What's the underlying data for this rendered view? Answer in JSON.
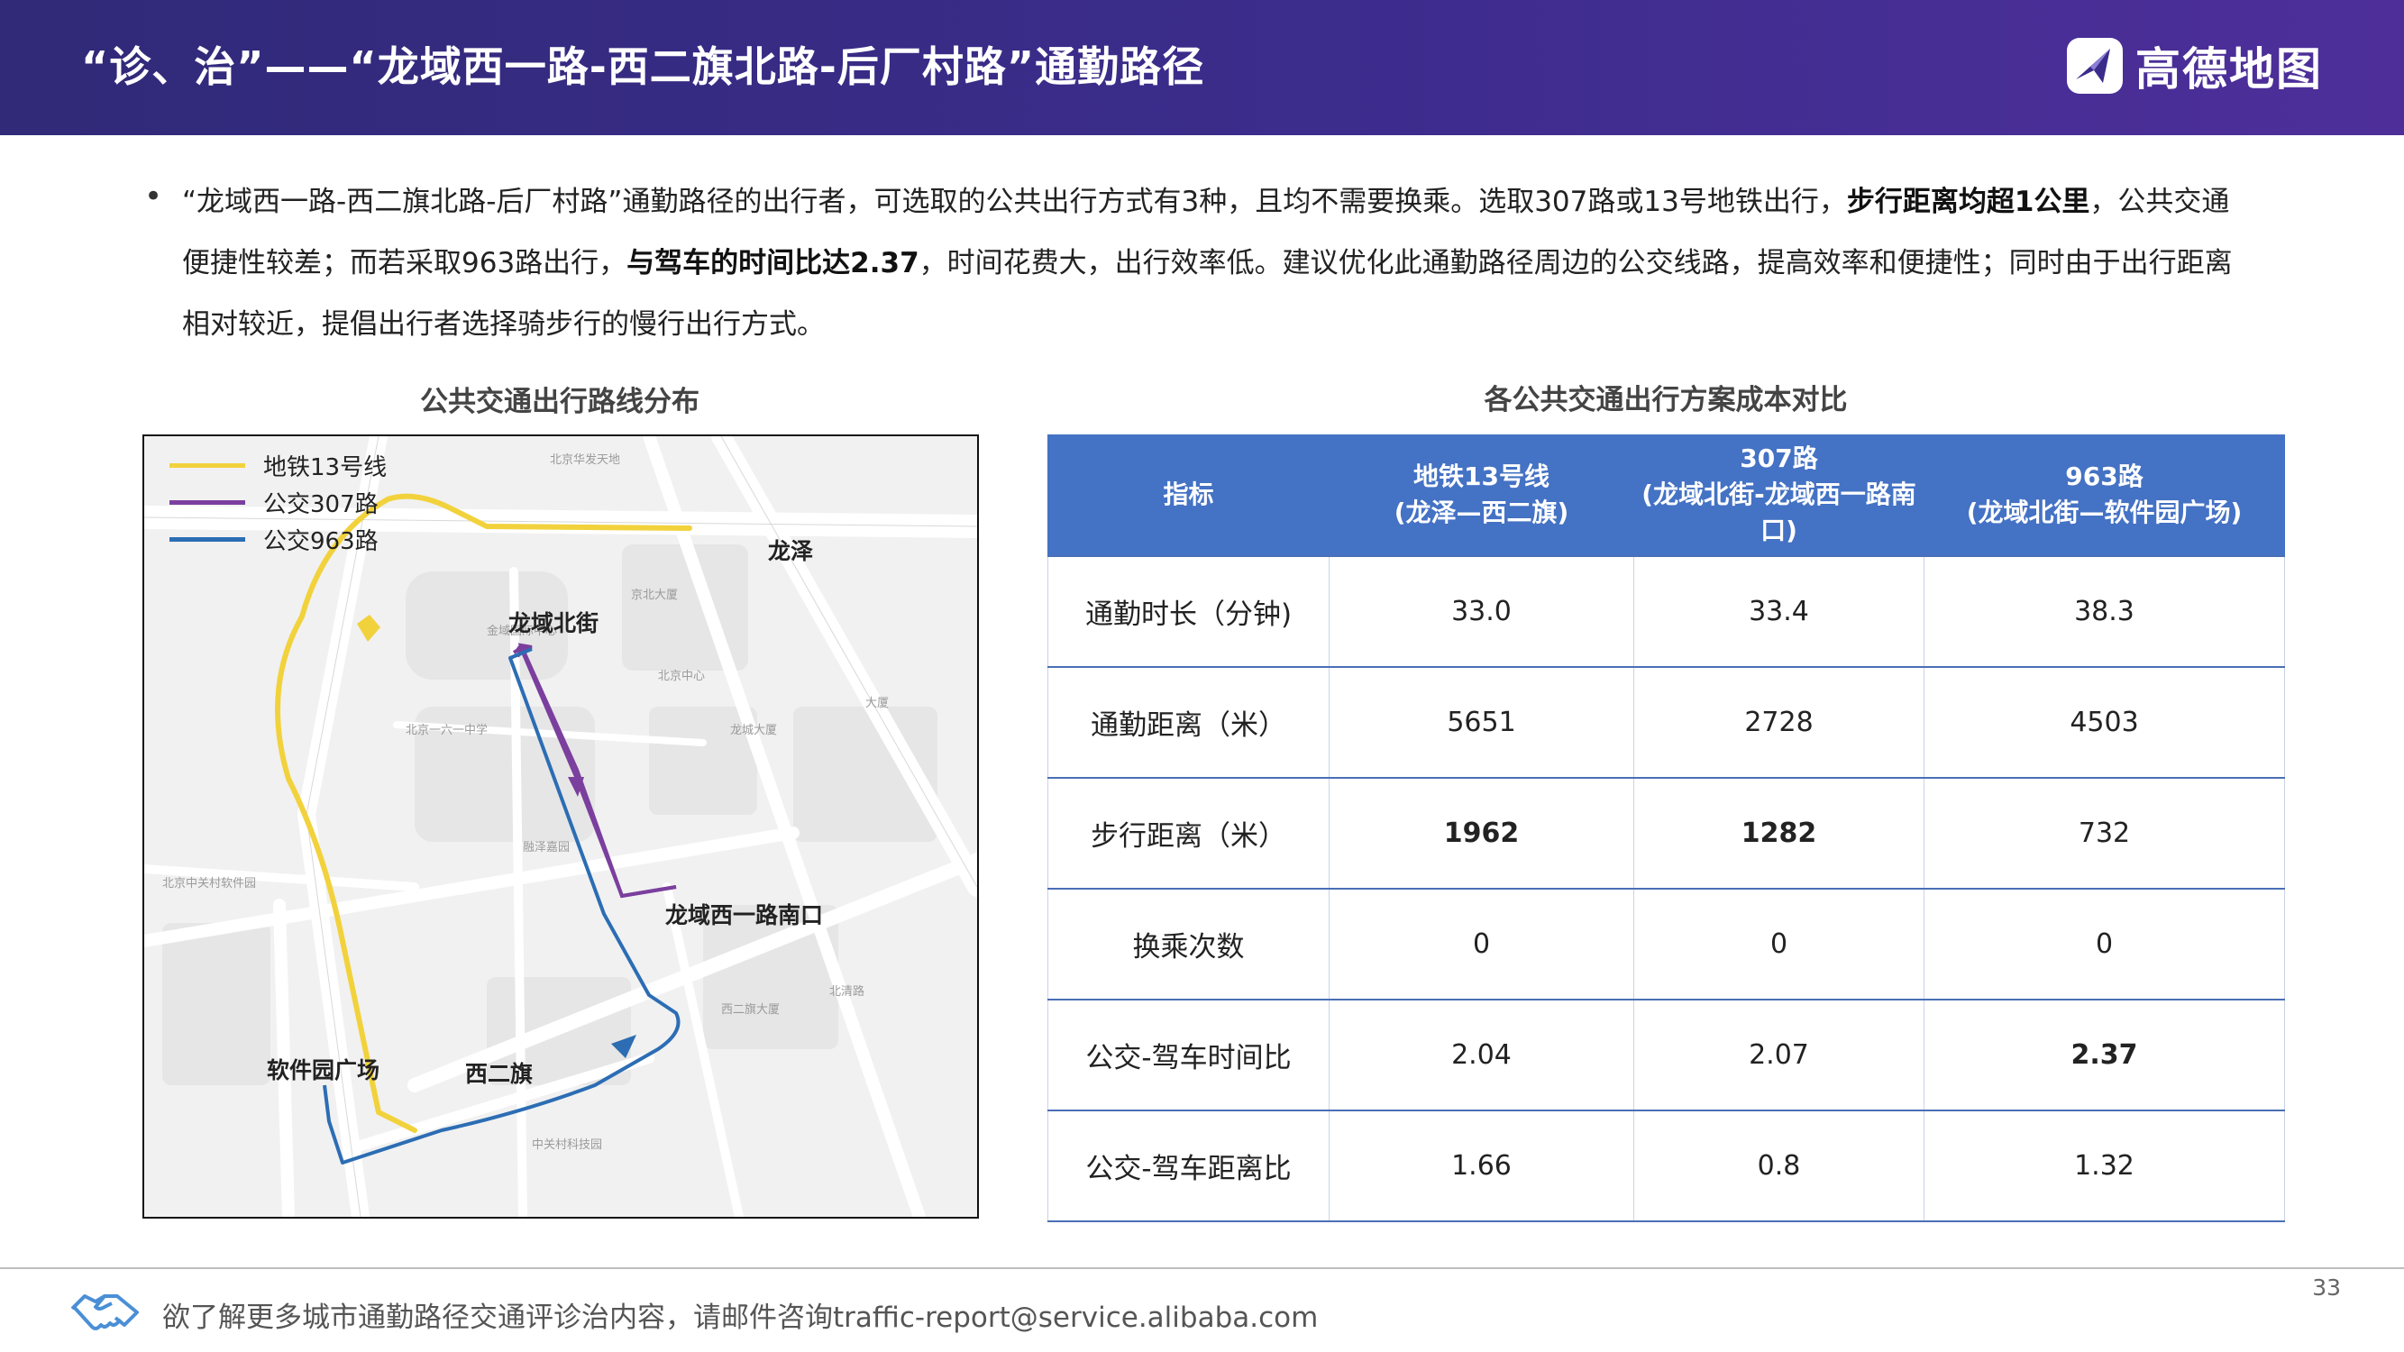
{
  "header": {
    "title": "“诊、治”——“龙域西一路-西二旗北路-后厂村路”通勤路径",
    "brand": "高德地图",
    "brand_icon": "gaode-logo-icon"
  },
  "paragraph": {
    "seg1": "“龙域西一路-西二旗北路-后厂村路”通勤路径的出行者，可选取的公共出行方式有3种，且均不需要换乘。选取307路或13号地铁出行，",
    "bold1": "步行距离均超1公里",
    "seg2": "，公共交通便捷性较差；而若采取963路出行，",
    "bold2": "与驾车的时间比达2.37",
    "seg3": "，时间花费大，出行效率低。建议优化此通勤路径周边的公交线路，提高效率和便捷性；同时由于出行距离相对较近，提倡出行者选择骑步行的慢行出行方式。"
  },
  "map": {
    "title": "公共交通出行路线分布",
    "legend": [
      {
        "label": "地铁13号线",
        "color": "#f2d23c"
      },
      {
        "label": "公交307路",
        "color": "#7b3f9e"
      },
      {
        "label": "公交963路",
        "color": "#2c6db4"
      }
    ],
    "labels": {
      "longze": "龙泽",
      "longyu_beijie": "龙域北街",
      "longyu_xiyilu_nankou": "龙域西一路南口",
      "ruanjianyuan_guangchang": "软件园广场",
      "xierqi": "西二旗"
    }
  },
  "table": {
    "title": "各公共交通出行方案成本对比",
    "headers": [
      {
        "line1": "指标",
        "line2": ""
      },
      {
        "line1": "地铁13号线",
        "line2": "(龙泽—西二旗)"
      },
      {
        "line1": "307路",
        "line2": "(龙域北街-龙域西一路南口)"
      },
      {
        "line1": "963路",
        "line2": "(龙域北街—软件园广场)"
      }
    ],
    "rows": [
      {
        "metric": "通勤时长（分钟)",
        "v1": "33.0",
        "v2": "33.4",
        "v3": "38.3"
      },
      {
        "metric": "通勤距离（米）",
        "v1": "5651",
        "v2": "2728",
        "v3": "4503"
      },
      {
        "metric": "步行距离（米）",
        "v1": "1962",
        "v2": "1282",
        "v3": "732"
      },
      {
        "metric": "换乘次数",
        "v1": "0",
        "v2": "0",
        "v3": "0"
      },
      {
        "metric": "公交-驾车时间比",
        "v1": "2.04",
        "v2": "2.07",
        "v3": "2.37"
      },
      {
        "metric": "公交-驾车距离比",
        "v1": "1.66",
        "v2": "0.8",
        "v3": "1.32"
      }
    ],
    "highlight_color": "#c00000"
  },
  "footer": {
    "text": "欲了解更多城市通勤路径交通评诊治内容，请邮件咨询traffic-report@service.alibaba.com",
    "page_number": "33",
    "icon": "handshake-icon"
  }
}
